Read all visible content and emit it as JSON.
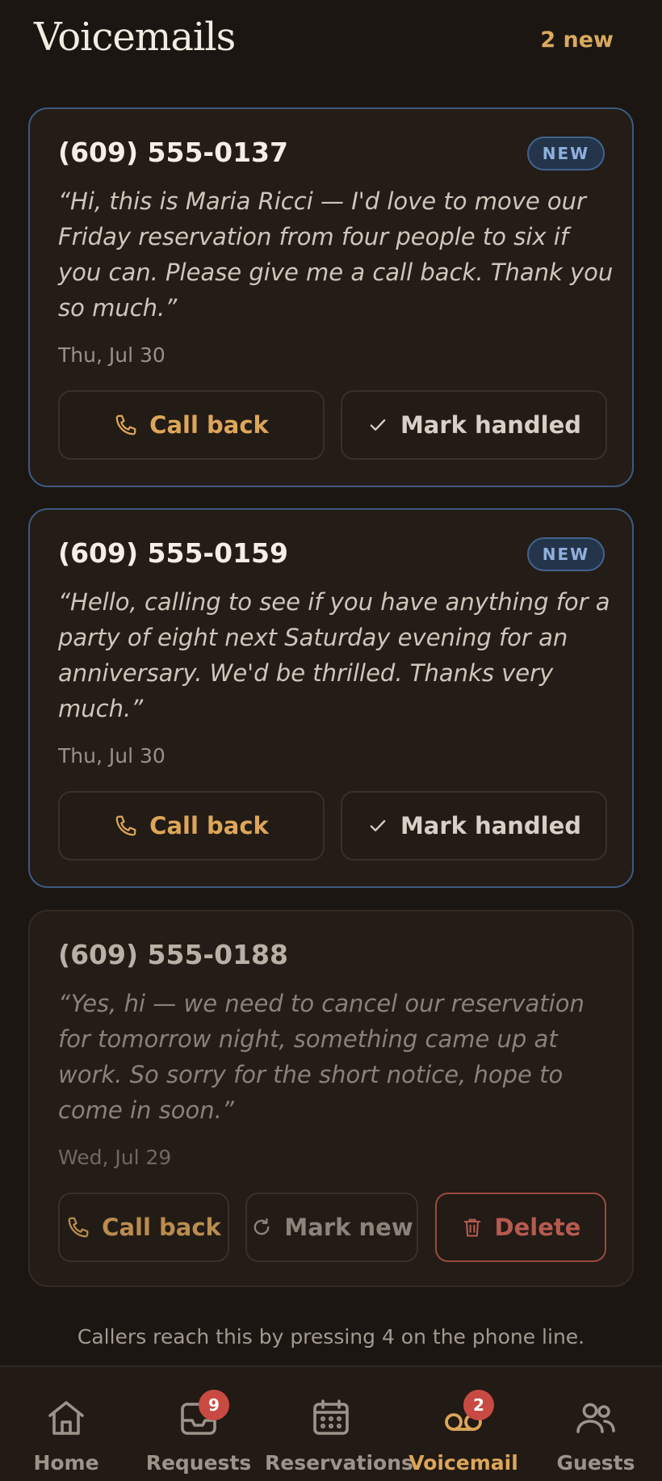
{
  "header": {
    "title": "Voicemails",
    "new_count": "2 new"
  },
  "voicemails": [
    {
      "phone": "(609) 555-0137",
      "badge": "NEW",
      "transcript": "“Hi, this is Maria Ricci — I'd love to move our Friday reservation from four people to six if you can. Please give me a call back. Thank you so much.”",
      "date": "Thu, Jul 30",
      "actions": {
        "call_back": "Call back",
        "mark_handled": "Mark handled"
      }
    },
    {
      "phone": "(609) 555-0159",
      "badge": "NEW",
      "transcript": "“Hello, calling to see if you have anything for a party of eight next Saturday evening for an anniversary. We'd be thrilled. Thanks very much.”",
      "date": "Thu, Jul 30",
      "actions": {
        "call_back": "Call back",
        "mark_handled": "Mark handled"
      }
    },
    {
      "phone": "(609) 555-0188",
      "transcript": "“Yes, hi — we need to cancel our reservation for tomorrow night, something came up at work. So sorry for the short notice, hope to come in soon.”",
      "date": "Wed, Jul 29",
      "actions": {
        "call_back": "Call back",
        "mark_new": "Mark new",
        "delete": "Delete"
      }
    }
  ],
  "footer_note": "Callers reach this by pressing 4 on the phone line.",
  "tabs": [
    {
      "label": "Home",
      "icon": "home-icon"
    },
    {
      "label": "Requests",
      "icon": "inbox-icon",
      "badge": "9"
    },
    {
      "label": "Reservations",
      "icon": "calendar-icon"
    },
    {
      "label": "Voicemail",
      "icon": "voicemail-icon",
      "badge": "2",
      "active": true
    },
    {
      "label": "Guests",
      "icon": "users-icon"
    }
  ],
  "colors": {
    "accent": "#dca659",
    "new_border": "#3d5a80",
    "badge_red": "#c94a43",
    "background": "#1b1612"
  }
}
